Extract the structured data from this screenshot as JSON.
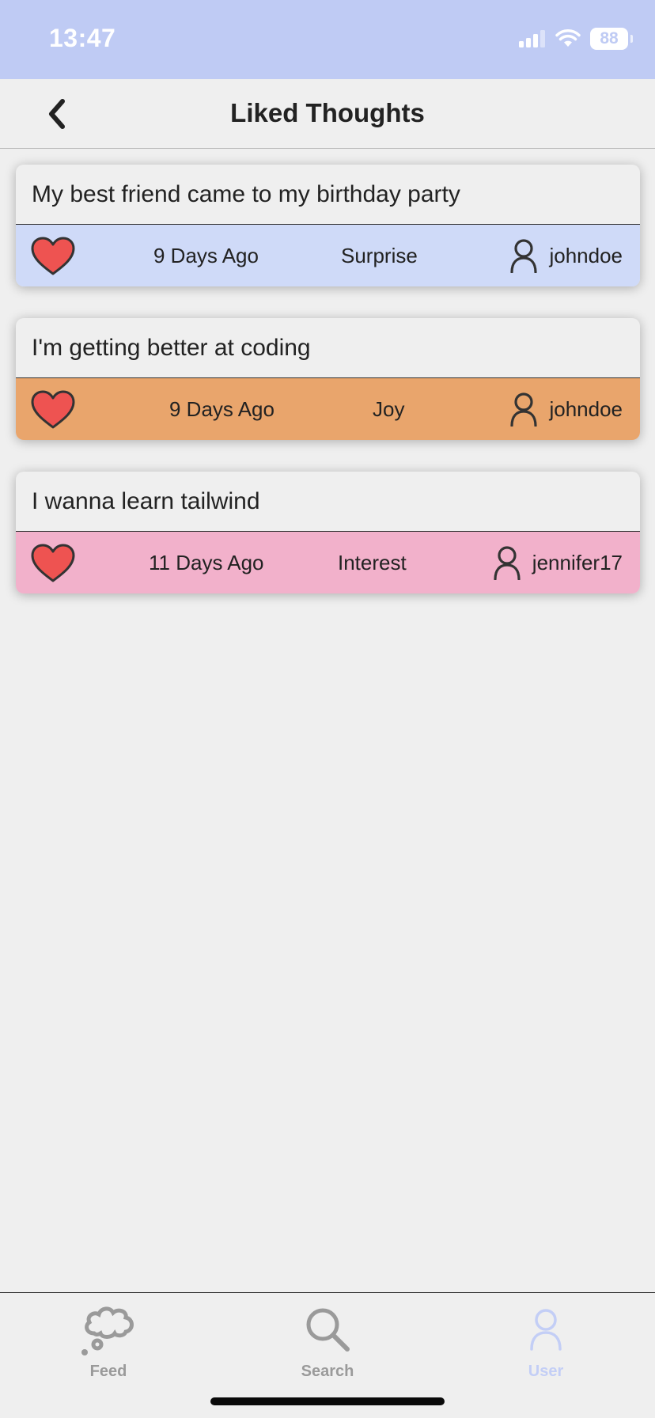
{
  "status_bar": {
    "time": "13:47",
    "battery": "88"
  },
  "header": {
    "title": "Liked Thoughts"
  },
  "thoughts": [
    {
      "text": "My best friend came to my birthday party",
      "time": "9 Days Ago",
      "emotion": "Surprise",
      "user": "johndoe",
      "color": "#cfdaf8"
    },
    {
      "text": "I'm getting better at coding",
      "time": "9 Days Ago",
      "emotion": "Joy",
      "user": "johndoe",
      "color": "#e9a56c"
    },
    {
      "text": "I wanna learn tailwind",
      "time": "11 Days Ago",
      "emotion": "Interest",
      "user": "jennifer17",
      "color": "#f2b1cb"
    }
  ],
  "tabs": [
    {
      "label": "Feed",
      "icon": "thought-cloud-icon",
      "color": "#9a9a9a",
      "active": false
    },
    {
      "label": "Search",
      "icon": "search-icon",
      "color": "#9a9a9a",
      "active": false
    },
    {
      "label": "User",
      "icon": "user-icon",
      "color": "#c3cef6",
      "active": true
    }
  ],
  "colors": {
    "status_bar": "#bfcbf4",
    "heart": "#ee5351",
    "background": "#efefef"
  }
}
